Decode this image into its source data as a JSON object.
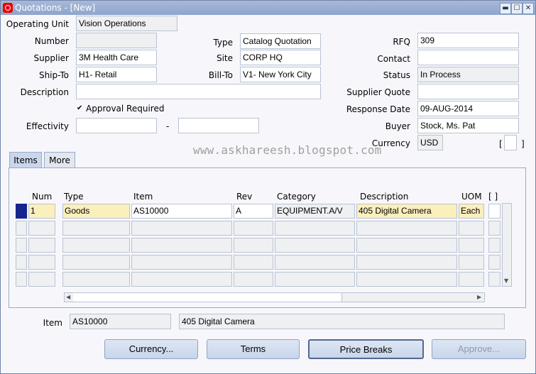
{
  "window": {
    "title": "Quotations - [New]",
    "minimize": "▬",
    "maximize": "☐",
    "close": "✕"
  },
  "header": {
    "operating_unit_label": "Operating Unit",
    "operating_unit": "Vision Operations",
    "number_label": "Number",
    "number": "",
    "type_label": "Type",
    "type": "Catalog Quotation",
    "rfq_label": "RFQ",
    "rfq": "309",
    "supplier_label": "Supplier",
    "supplier": "3M Health Care",
    "site_label": "Site",
    "site": "CORP HQ",
    "contact_label": "Contact",
    "contact": "",
    "shipto_label": "Ship-To",
    "shipto": "H1- Retail",
    "billto_label": "Bill-To",
    "billto": "V1- New York City",
    "status_label": "Status",
    "status": "In Process",
    "description_label": "Description",
    "description": "",
    "supplier_quote_label": "Supplier Quote",
    "supplier_quote": "",
    "approval_label": "Approval Required",
    "approval_checked": true,
    "check_mark": "✔",
    "response_date_label": "Response Date",
    "response_date": "09-AUG-2014",
    "effectivity_label": "Effectivity",
    "effectivity_from": "",
    "effectivity_dash": "-",
    "effectivity_to": "",
    "buyer_label": "Buyer",
    "buyer": "Stock, Ms. Pat",
    "currency_label": "Currency",
    "currency": "USD",
    "dff_open": "[",
    "dff_close": "]"
  },
  "watermark": "www.askhareesh.blogspot.com",
  "tabs": [
    {
      "label": "Items",
      "active": true
    },
    {
      "label": "More",
      "active": false
    }
  ],
  "lines": {
    "headers": {
      "num": "Num",
      "type": "Type",
      "item": "Item",
      "rev": "Rev",
      "category": "Category",
      "description": "Description",
      "uom": "UOM",
      "dff": "[ ]"
    },
    "rows": [
      {
        "num": "1",
        "type": "Goods",
        "item": "AS10000",
        "rev": "A",
        "category": "EQUIPMENT.A/V",
        "description": "405 Digital Camera",
        "uom": "Each"
      },
      {
        "num": "",
        "type": "",
        "item": "",
        "rev": "",
        "category": "",
        "description": "",
        "uom": ""
      },
      {
        "num": "",
        "type": "",
        "item": "",
        "rev": "",
        "category": "",
        "description": "",
        "uom": ""
      },
      {
        "num": "",
        "type": "",
        "item": "",
        "rev": "",
        "category": "",
        "description": "",
        "uom": ""
      },
      {
        "num": "",
        "type": "",
        "item": "",
        "rev": "",
        "category": "",
        "description": "",
        "uom": ""
      }
    ]
  },
  "footer": {
    "item_label": "Item",
    "item": "AS10000",
    "item_description": "405 Digital Camera"
  },
  "buttons": {
    "currency": "Currency...",
    "terms": "Terms",
    "price_breaks": "Price Breaks",
    "approve": "Approve..."
  }
}
